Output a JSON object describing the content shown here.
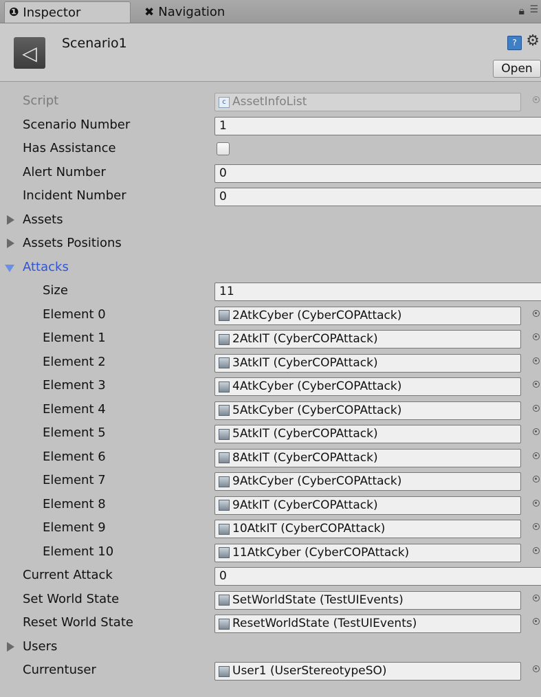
{
  "tabs": {
    "inspector": {
      "glyph": "❶",
      "label": "Inspector"
    },
    "navigation": {
      "glyph": "✖",
      "label": "Navigation"
    },
    "lock_icon": "lock-icon",
    "menu_icon": "menu-icon"
  },
  "header": {
    "title": "Scenario1",
    "help_glyph": "?",
    "gear_glyph": "⚙",
    "open_label": "Open"
  },
  "properties": {
    "script": {
      "label": "Script",
      "value": "AssetInfoList"
    },
    "scenario_number": {
      "label": "Scenario Number",
      "value": "1"
    },
    "has_assistance": {
      "label": "Has Assistance",
      "checked": false
    },
    "alert_number": {
      "label": "Alert Number",
      "value": "0"
    },
    "incident_number": {
      "label": "Incident Number",
      "value": "0"
    },
    "assets": {
      "label": "Assets",
      "expanded": false
    },
    "assets_positions": {
      "label": "Assets Positions",
      "expanded": false
    },
    "attacks": {
      "label": "Attacks",
      "expanded": true,
      "size_label": "Size",
      "size_value": "11",
      "elements": [
        {
          "label": "Element 0",
          "value": "2AtkCyber (CyberCOPAttack)"
        },
        {
          "label": "Element 1",
          "value": "2AtkIT (CyberCOPAttack)"
        },
        {
          "label": "Element 2",
          "value": "3AtkIT (CyberCOPAttack)"
        },
        {
          "label": "Element 3",
          "value": "4AtkCyber (CyberCOPAttack)"
        },
        {
          "label": "Element 4",
          "value": "5AtkCyber (CyberCOPAttack)"
        },
        {
          "label": "Element 5",
          "value": "5AtkIT (CyberCOPAttack)"
        },
        {
          "label": "Element 6",
          "value": "8AtkIT (CyberCOPAttack)"
        },
        {
          "label": "Element 7",
          "value": "9AtkCyber (CyberCOPAttack)"
        },
        {
          "label": "Element 8",
          "value": "9AtkIT (CyberCOPAttack)"
        },
        {
          "label": "Element 9",
          "value": "10AtkIT (CyberCOPAttack)"
        },
        {
          "label": "Element 10",
          "value": "11AtkCyber (CyberCOPAttack)"
        }
      ]
    },
    "current_attack": {
      "label": "Current Attack",
      "value": "0"
    },
    "set_world_state": {
      "label": "Set World State",
      "value": "SetWorldState (TestUIEvents)"
    },
    "reset_world_state": {
      "label": "Reset World State",
      "value": "ResetWorldState (TestUIEvents)"
    },
    "users": {
      "label": "Users",
      "expanded": false
    },
    "currentuser": {
      "label": "Currentuser",
      "value": "User1 (UserStereotypeSO)"
    }
  }
}
